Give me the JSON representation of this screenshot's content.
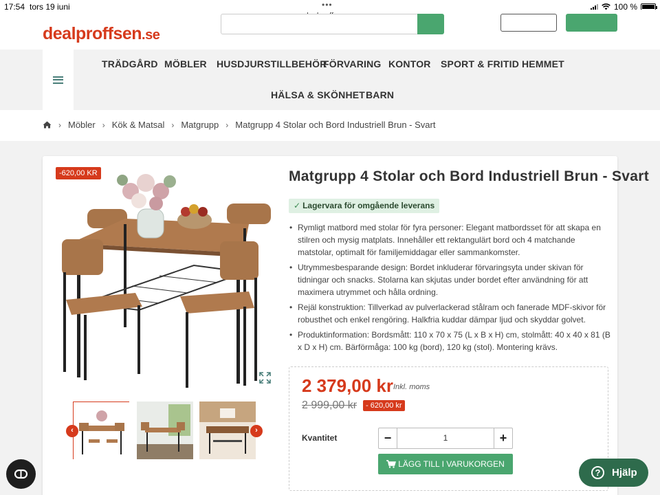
{
  "status_bar": {
    "time": "17:54",
    "date": "tors 19 juni",
    "battery": "100 %"
  },
  "browser": {
    "url": "dealproffsen.se"
  },
  "header": {
    "logo_name": "dealproffsen",
    "logo_domain": ".se"
  },
  "nav": {
    "items": [
      "TRÄDGÅRD",
      "MÖBLER",
      "HUSDJURSTILLBEHÖR",
      "FÖRVARING",
      "KONTOR",
      "SPORT & FRITID",
      "HEMMET",
      "HÄLSA & SKÖNHET",
      "BARN"
    ]
  },
  "breadcrumb": [
    "Möbler",
    "Kök & Matsal",
    "Matgrupp",
    "Matgrupp 4 Stolar och Bord Industriell Brun - Svart"
  ],
  "product": {
    "discount_badge": "-620,00 KR",
    "title": "Matgrupp 4 Stolar och Bord Industriell Brun - Svart",
    "stock": "Lagervara för omgående leverans",
    "bullets": [
      "Rymligt matbord med stolar för fyra personer: Elegant matbordsset för att skapa en stilren och mysig matplats. Innehåller ett rektangulärt bord och 4 matchande matstolar, optimalt för familjemiddagar eller sammankomster.",
      "Utrymmesbesparande design: Bordet inkluderar förvaringsyta under skivan för tidningar och snacks. Stolarna kan skjutas under bordet efter användning för att maximera utrymmet och hålla ordning.",
      "Rejäl konstruktion: Tillverkad av pulverlackerad stålram och fanerade MDF-skivor för robusthet och enkel rengöring. Halkfria kuddar dämpar ljud och skyddar golvet.",
      "Produktinformation: Bordsmått: 110 x 70 x 75 (L x B x H) cm, stolmått: 40 x 40 x 81 (B x D x H) cm. Bärförmåga: 100 kg (bord), 120 kg (stol). Montering krävs."
    ],
    "price": "2 379,00 kr",
    "price_note": "Inkl. moms",
    "old_price": "2 999,00 kr",
    "save_badge": "- 620,00 kr",
    "quantity_label": "Kvantitet",
    "quantity": "1",
    "add_to_cart": "LÄGG TILL I VARUKORGEN"
  },
  "help": {
    "label": "Hjälp"
  },
  "colors": {
    "brand_red": "#d63a1c",
    "brand_green": "#4aa66f",
    "help_green": "#2e6b4c"
  },
  "icons": [
    "home-icon",
    "chevron-right-icon",
    "menu-icon",
    "expand-icon",
    "cart-icon",
    "help-icon",
    "chat-icon"
  ]
}
